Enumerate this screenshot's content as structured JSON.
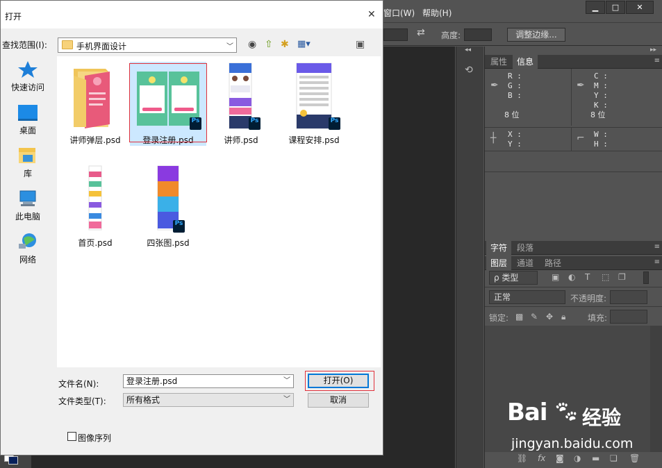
{
  "photoshop": {
    "menus": [
      "窗口(W)",
      "帮助(H)"
    ],
    "menu_first_visible_fragment": "窗口(W)",
    "options_bar": {
      "height_label": "高度:",
      "refine_edge_button": "调整边缘..."
    },
    "panels": {
      "top_tabs": [
        "属性",
        "信息"
      ],
      "info": {
        "r": "R :",
        "g": "G :",
        "b": "B :",
        "c": "C :",
        "m": "M :",
        "y": "Y :",
        "k": "K :",
        "bits_left": "8 位",
        "bits_right": "8 位",
        "x": "X :",
        "y2": "Y :",
        "w": "W :",
        "h": "H :"
      },
      "mid_tabs": [
        "字符",
        "段落"
      ],
      "layer_tabs": [
        "图层",
        "通道",
        "路径"
      ],
      "layer_filter": "ρ 类型",
      "blend_mode": "正常",
      "opacity_label": "不透明度:",
      "lock_label": "锁定:",
      "fill_label": "填充:"
    }
  },
  "dialog": {
    "title": "打开",
    "close_glyph": "✕",
    "look_in_label": "查找范围(I):",
    "look_in_value": "手机界面设计",
    "places": [
      {
        "label": "快速访问",
        "icon": "star-icon"
      },
      {
        "label": "桌面",
        "icon": "desktop-icon"
      },
      {
        "label": "库",
        "icon": "library-icon"
      },
      {
        "label": "此电脑",
        "icon": "computer-icon"
      },
      {
        "label": "网络",
        "icon": "network-icon"
      }
    ],
    "files": [
      {
        "name": "讲师弹层.psd",
        "type": "folder"
      },
      {
        "name": "登录注册.psd",
        "type": "psd",
        "selected": true
      },
      {
        "name": "讲师.psd",
        "type": "psd"
      },
      {
        "name": "课程安排.psd",
        "type": "psd"
      },
      {
        "name": "首页.psd",
        "type": "psd"
      },
      {
        "name": "四张图.psd",
        "type": "psd"
      }
    ],
    "ps_badge": "Ps",
    "filename_label": "文件名(N):",
    "filename_value": "登录注册.psd",
    "filetype_label": "文件类型(T):",
    "filetype_value": "所有格式",
    "open_button": "打开(O)",
    "cancel_button": "取消",
    "image_sequence_label": "图像序列"
  },
  "watermark": {
    "brand": "Bai",
    "brand2": "经验",
    "url": "jingyan.baidu.com"
  },
  "colors": {
    "selection_blue": "#cce8ff",
    "highlight_red": "#e0303a",
    "ps_dark": "#535353"
  }
}
